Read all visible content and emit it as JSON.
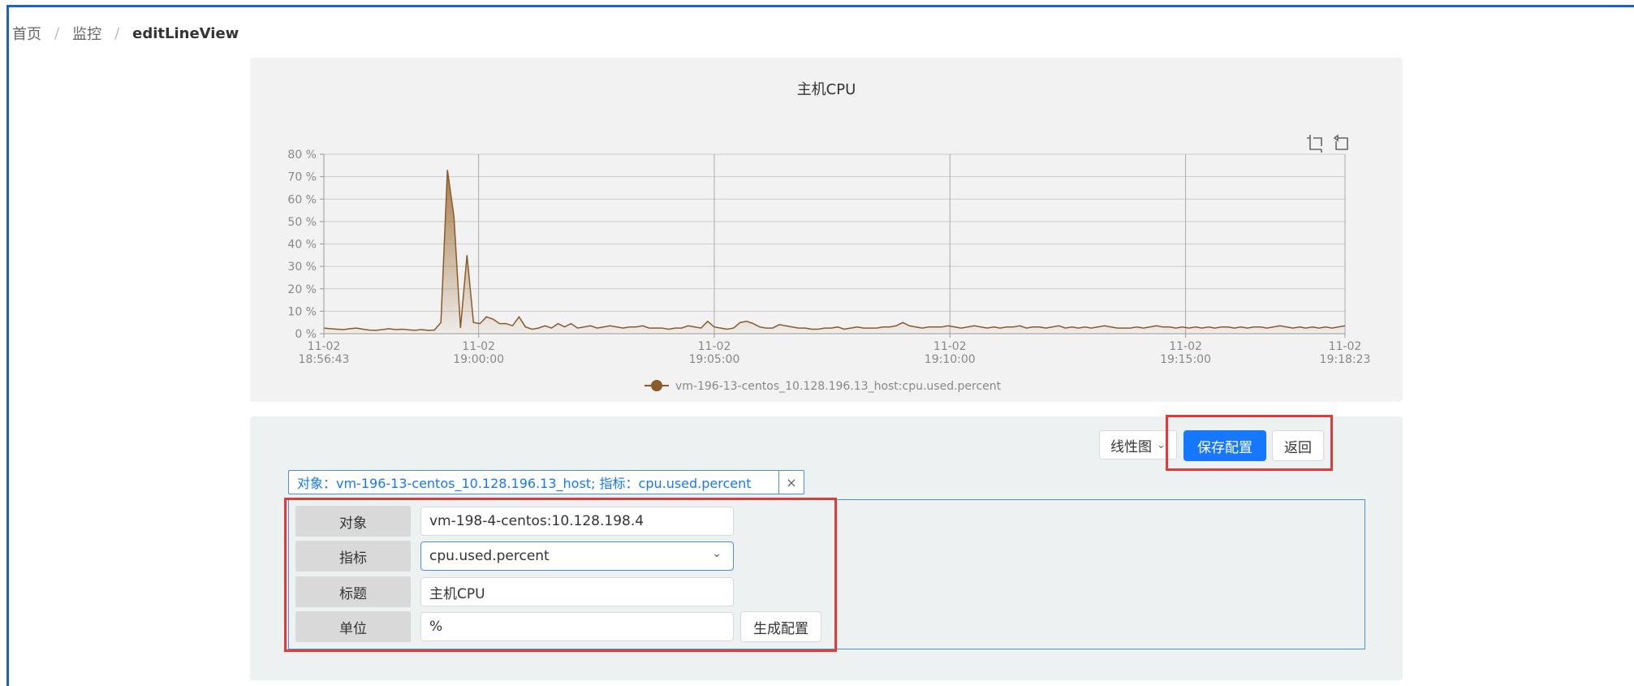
{
  "breadcrumb": {
    "home": "首页",
    "section": "监控",
    "current": "editLineView"
  },
  "chart_data": {
    "type": "line",
    "title": "主机CPU",
    "series": [
      {
        "name": "vm-196-13-centos_10.128.196.13_host:cpu.used.percent",
        "values": [
          2.5,
          2.2,
          2.0,
          1.8,
          2.2,
          2.5,
          2.0,
          1.6,
          1.5,
          1.8,
          2.2,
          1.8,
          2.0,
          1.7,
          1.5,
          1.8,
          1.5,
          1.6,
          5.0,
          73,
          52,
          2.5,
          35,
          5.0,
          4.5,
          7.5,
          6.5,
          4.5,
          4.5,
          3.5,
          7.5,
          3.0,
          2.0,
          2.5,
          3.5,
          2.5,
          4.5,
          3.0,
          4.5,
          2.5,
          3.0,
          3.5,
          2.5,
          3.0,
          3.5,
          3.0,
          2.5,
          3.0,
          3.0,
          3.5,
          2.5,
          2.5,
          2.5,
          2.0,
          2.5,
          2.5,
          3.5,
          3.0,
          2.5,
          5.5,
          3.0,
          2.5,
          2.0,
          2.5,
          5.0,
          5.5,
          4.5,
          3.0,
          2.5,
          2.5,
          4.0,
          3.5,
          3.0,
          2.5,
          2.5,
          2.0,
          2.0,
          2.5,
          2.5,
          3.0,
          2.0,
          2.5,
          3.0,
          2.5,
          2.5,
          2.5,
          3.0,
          3.0,
          3.5,
          5.0,
          3.5,
          3.0,
          2.5,
          3.0,
          3.0,
          3.0,
          3.5,
          3.0,
          2.5,
          3.0,
          3.5,
          3.0,
          2.5,
          3.0,
          2.5,
          3.0,
          3.0,
          3.5,
          2.5,
          3.0,
          3.0,
          2.5,
          3.0,
          3.5,
          2.5,
          3.0,
          2.5,
          3.0,
          2.5,
          3.0,
          3.5,
          3.0,
          2.5,
          2.5,
          2.5,
          3.0,
          2.5,
          3.0,
          3.5,
          3.0,
          3.0,
          2.5,
          3.0,
          2.5,
          3.0,
          2.5,
          3.0,
          2.5,
          3.0,
          3.0,
          2.5,
          3.0,
          2.5,
          3.0,
          3.0,
          2.5,
          3.0,
          3.5,
          3.0,
          2.5,
          3.0,
          2.5,
          3.0,
          2.5,
          3.0,
          2.5,
          3.0,
          3.5
        ]
      }
    ],
    "x_start": "18:56:43",
    "x_end": "19:18:23",
    "x_ticks": [
      {
        "date": "11-02",
        "time": "18:56:43"
      },
      {
        "date": "11-02",
        "time": "19:00:00"
      },
      {
        "date": "11-02",
        "time": "19:05:00"
      },
      {
        "date": "11-02",
        "time": "19:10:00"
      },
      {
        "date": "11-02",
        "time": "19:15:00"
      },
      {
        "date": "11-02",
        "time": "19:18:23"
      }
    ],
    "y_ticks": [
      "0 %",
      "10 %",
      "20 %",
      "30 %",
      "40 %",
      "50 %",
      "60 %",
      "70 %",
      "80 %"
    ],
    "ylim": [
      0,
      80
    ],
    "grid": true,
    "legend_position": "bottom",
    "colors": {
      "line": "#8b5a2b",
      "area_top": "#a0703a",
      "grid": "#cccccc"
    }
  },
  "toolbox": {
    "zoom_icon": "zoom-select-icon",
    "restore_icon": "zoom-restore-icon"
  },
  "controls": {
    "chart_type": "线性图",
    "save": "保存配置",
    "back": "返回"
  },
  "tag": {
    "text": "对象：vm-196-13-centos_10.128.196.13_host; 指标：cpu.used.percent",
    "close": "×"
  },
  "form": {
    "object_label": "对象",
    "object_value": "vm-198-4-centos:10.128.198.4",
    "metric_label": "指标",
    "metric_value": "cpu.used.percent",
    "title_label": "标题",
    "title_value": "主机CPU",
    "unit_label": "单位",
    "unit_value": "%",
    "generate": "生成配置"
  },
  "colors": {
    "primary": "#1677ff",
    "highlight": "#e53935",
    "panel": "#f2f2f2"
  }
}
